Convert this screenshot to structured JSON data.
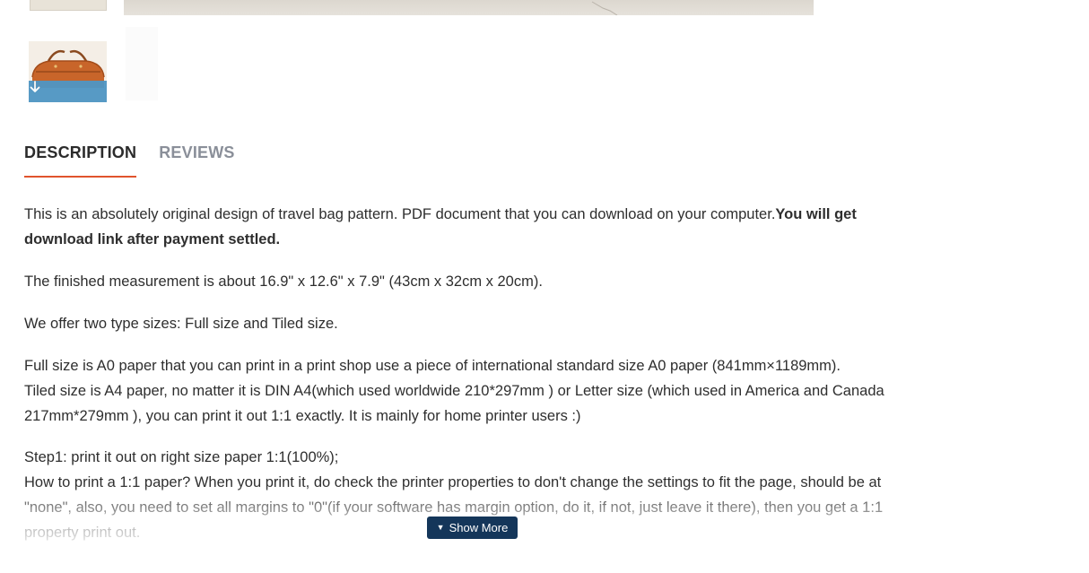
{
  "gallery": {
    "thumb_down_icon": "arrow-down-icon",
    "accent_color": "#4f96c4"
  },
  "tabs": [
    {
      "label": "DESCRIPTION",
      "active": true
    },
    {
      "label": "REVIEWS",
      "active": false
    }
  ],
  "tab_underline_color": "#e0532d",
  "description": {
    "p1_normal": "This is an absolutely original design of travel bag pattern. PDF document that you can download on your computer.",
    "p1_bold": "You will get download link after payment settled.",
    "p2": "The finished measurement is about 16.9\" x 12.6\" x 7.9\" (43cm x 32cm x 20cm).",
    "p3": "We offer two type sizes: Full size and Tiled size.",
    "p4_line1": "Full size is A0 paper that you can print in a print shop use a piece of international standard size A0 paper (841mm×1189mm).",
    "p4_line2": "Tiled size is A4 paper, no matter it is DIN A4(which used worldwide 210*297mm ) or Letter size (which used in America and Canada 217mm*279mm ), you can print it out 1:1 exactly. It is mainly for home printer users :)",
    "p5_line1": "Step1: print it out on right size paper 1:1(100%);",
    "p5_line2": "How to print a 1:1 paper? When you print it, do check the printer properties to don't change the settings to fit the page, should be at \"none\", also, you need to set all margins to \"0\"(if your software has margin option, do it, if not, just leave it there), then you get a 1:1 property print out."
  },
  "show_more": {
    "label": "Show More",
    "icon": "caret-down-icon",
    "color": "#14365a"
  }
}
